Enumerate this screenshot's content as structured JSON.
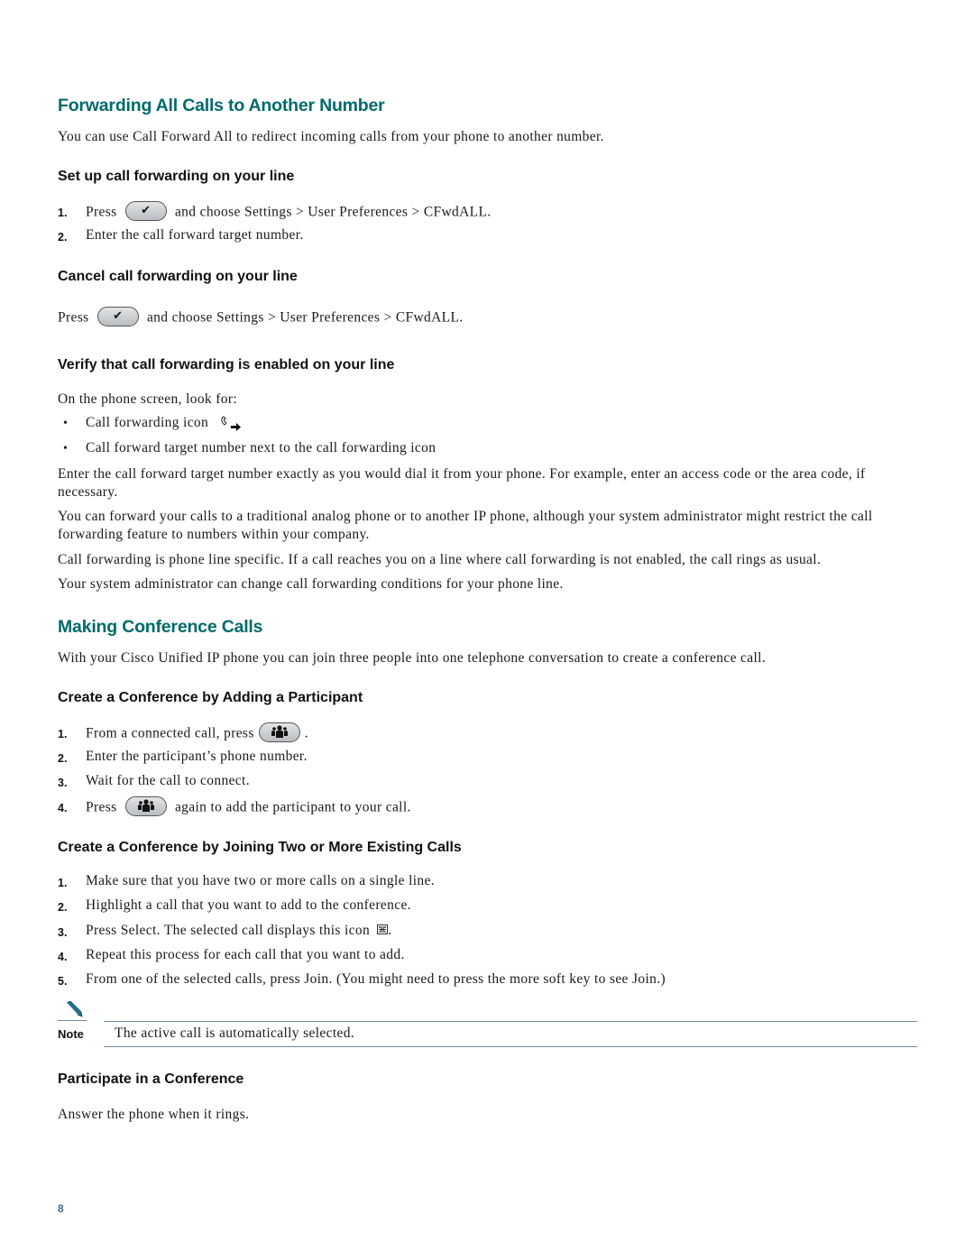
{
  "section_forwarding": {
    "title": "Forwarding All Calls to Another Number",
    "intro": "You can use Call Forward All to redirect incoming calls from your phone to another number.",
    "setup": {
      "heading": "Set up call forwarding on your line",
      "steps": [
        {
          "number": "1.",
          "before": "Press",
          "key_icon": "settings-checkmark-icon",
          "after": "and choose Settings > User Preferences > CFwdALL."
        },
        {
          "number": "2.",
          "text": "Enter the call forward target number."
        }
      ]
    },
    "cancel": {
      "heading": "Cancel call forwarding on your line",
      "before": "Press",
      "key_icon": "settings-checkmark-icon",
      "after": "and choose Settings > User Preferences > CFwdALL."
    },
    "verify": {
      "heading": "Verify that call forwarding is enabled on your line",
      "intro": "On the phone screen, look for:",
      "bullets": [
        {
          "text": "Call forwarding icon",
          "icon": "call-forward-icon"
        },
        {
          "text": "Call forward target number next to the call forwarding icon"
        }
      ]
    },
    "paragraphs": [
      "Enter the call forward target number exactly as you would dial it from your phone. For example, enter an access code or the area code, if necessary.",
      "You can forward your calls to a traditional analog phone or to another IP phone, although your system administrator might restrict the call forwarding feature to numbers within your company.",
      "Call forwarding is phone line specific. If a call reaches you on a line where call forwarding is not enabled, the call rings as usual.",
      "Your system administrator can change call forwarding conditions for your phone line."
    ]
  },
  "section_conference": {
    "title": "Making Conference Calls",
    "intro": "With your Cisco Unified IP phone you can join three people into one telephone conversation to create a conference call.",
    "adding": {
      "heading": "Create a Conference by Adding a Participant",
      "steps": [
        {
          "number": "1.",
          "before": "From a connected call, press",
          "key_icon": "conference-icon",
          "after": "."
        },
        {
          "number": "2.",
          "text": "Enter the participant’s phone number."
        },
        {
          "number": "3.",
          "text": "Wait for the call to connect."
        },
        {
          "number": "4.",
          "before": "Press",
          "key_icon": "conference-icon",
          "after": "again to add the participant to your call."
        }
      ]
    },
    "joining": {
      "heading": "Create a Conference by Joining Two or More Existing Calls",
      "steps": [
        {
          "number": "1.",
          "text": "Make sure that you have two or more calls on a single line."
        },
        {
          "number": "2.",
          "text": "Highlight a call that you want to add to the conference."
        },
        {
          "number": "3.",
          "before": "Press Select. The selected call displays this icon",
          "icon": "selected-call-icon",
          "after": "."
        },
        {
          "number": "4.",
          "text": "Repeat this process for each call that you want to add."
        },
        {
          "number": "5.",
          "text": "From one of the selected calls, press Join. (You might need to press the more soft key to see Join.)"
        }
      ],
      "note": {
        "label": "Note",
        "text": "The active call is automatically selected."
      }
    },
    "participate": {
      "heading": "Participate in a Conference",
      "text": "Answer the phone when it rings."
    }
  },
  "page_number": "8",
  "colors": {
    "heading_teal": "#006a6b",
    "note_rule": "#6d8aa0",
    "page_number": "#3d6e8e"
  }
}
